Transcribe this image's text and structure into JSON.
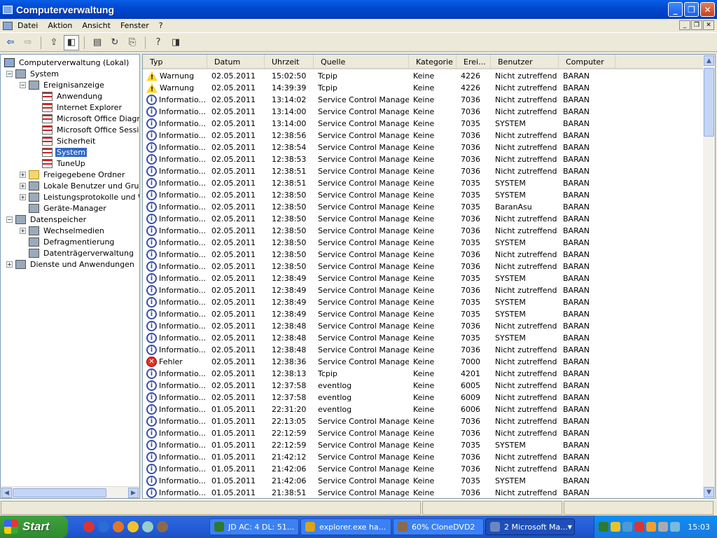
{
  "window": {
    "title": "Computerverwaltung"
  },
  "menubar": {
    "items": [
      "Datei",
      "Aktion",
      "Ansicht",
      "Fenster",
      "?"
    ]
  },
  "tree": {
    "nodes": [
      {
        "label": "Computerverwaltung (Lokal)",
        "icon": "computer-icon"
      },
      {
        "label": "System",
        "icon": "system-icon",
        "expander": "−"
      },
      {
        "label": "Ereignisanzeige",
        "icon": "event-viewer-icon",
        "expander": "−"
      },
      {
        "label": "Anwendung",
        "icon": "log-icon"
      },
      {
        "label": "Internet Explorer",
        "icon": "log-icon"
      },
      {
        "label": "Microsoft Office Diagnos",
        "icon": "log-icon"
      },
      {
        "label": "Microsoft Office Session",
        "icon": "log-icon"
      },
      {
        "label": "Sicherheit",
        "icon": "log-icon"
      },
      {
        "label": "System",
        "icon": "log-icon",
        "selected": true
      },
      {
        "label": "TuneUp",
        "icon": "log-icon"
      },
      {
        "label": "Freigegebene Ordner",
        "icon": "shared-folder-icon",
        "expander": "+"
      },
      {
        "label": "Lokale Benutzer und Gruppe",
        "icon": "users-icon",
        "expander": "+"
      },
      {
        "label": "Leistungsprotokolle und Wa",
        "icon": "performance-icon",
        "expander": "+"
      },
      {
        "label": "Geräte-Manager",
        "icon": "device-manager-icon"
      },
      {
        "label": "Datenspeicher",
        "icon": "storage-icon",
        "expander": "−"
      },
      {
        "label": "Wechselmedien",
        "icon": "removable-media-icon",
        "expander": "+"
      },
      {
        "label": "Defragmentierung",
        "icon": "defrag-icon"
      },
      {
        "label": "Datenträgerverwaltung",
        "icon": "disk-management-icon"
      },
      {
        "label": "Dienste und Anwendungen",
        "icon": "services-icon",
        "expander": "+"
      }
    ]
  },
  "list": {
    "columns": [
      "Typ",
      "Datum",
      "Uhrzeit",
      "Quelle",
      "Kategorie",
      "Erei...",
      "Benutzer",
      "Computer"
    ],
    "rows": [
      {
        "typ": "Warnung",
        "kind": "warn",
        "datum": "02.05.2011",
        "uhrzeit": "15:02:50",
        "quelle": "Tcpip",
        "kategorie": "Keine",
        "ereignis": "4226",
        "benutzer": "Nicht zutreffend",
        "computer": "BARAN"
      },
      {
        "typ": "Warnung",
        "kind": "warn",
        "datum": "02.05.2011",
        "uhrzeit": "14:39:39",
        "quelle": "Tcpip",
        "kategorie": "Keine",
        "ereignis": "4226",
        "benutzer": "Nicht zutreffend",
        "computer": "BARAN"
      },
      {
        "typ": "Informatio...",
        "kind": "info",
        "datum": "02.05.2011",
        "uhrzeit": "13:14:02",
        "quelle": "Service Control Manager",
        "kategorie": "Keine",
        "ereignis": "7036",
        "benutzer": "Nicht zutreffend",
        "computer": "BARAN"
      },
      {
        "typ": "Informatio...",
        "kind": "info",
        "datum": "02.05.2011",
        "uhrzeit": "13:14:00",
        "quelle": "Service Control Manager",
        "kategorie": "Keine",
        "ereignis": "7036",
        "benutzer": "Nicht zutreffend",
        "computer": "BARAN"
      },
      {
        "typ": "Informatio...",
        "kind": "info",
        "datum": "02.05.2011",
        "uhrzeit": "13:14:00",
        "quelle": "Service Control Manager",
        "kategorie": "Keine",
        "ereignis": "7035",
        "benutzer": "SYSTEM",
        "computer": "BARAN"
      },
      {
        "typ": "Informatio...",
        "kind": "info",
        "datum": "02.05.2011",
        "uhrzeit": "12:38:56",
        "quelle": "Service Control Manager",
        "kategorie": "Keine",
        "ereignis": "7036",
        "benutzer": "Nicht zutreffend",
        "computer": "BARAN"
      },
      {
        "typ": "Informatio...",
        "kind": "info",
        "datum": "02.05.2011",
        "uhrzeit": "12:38:54",
        "quelle": "Service Control Manager",
        "kategorie": "Keine",
        "ereignis": "7036",
        "benutzer": "Nicht zutreffend",
        "computer": "BARAN"
      },
      {
        "typ": "Informatio...",
        "kind": "info",
        "datum": "02.05.2011",
        "uhrzeit": "12:38:53",
        "quelle": "Service Control Manager",
        "kategorie": "Keine",
        "ereignis": "7036",
        "benutzer": "Nicht zutreffend",
        "computer": "BARAN"
      },
      {
        "typ": "Informatio...",
        "kind": "info",
        "datum": "02.05.2011",
        "uhrzeit": "12:38:51",
        "quelle": "Service Control Manager",
        "kategorie": "Keine",
        "ereignis": "7036",
        "benutzer": "Nicht zutreffend",
        "computer": "BARAN"
      },
      {
        "typ": "Informatio...",
        "kind": "info",
        "datum": "02.05.2011",
        "uhrzeit": "12:38:51",
        "quelle": "Service Control Manager",
        "kategorie": "Keine",
        "ereignis": "7035",
        "benutzer": "SYSTEM",
        "computer": "BARAN"
      },
      {
        "typ": "Informatio...",
        "kind": "info",
        "datum": "02.05.2011",
        "uhrzeit": "12:38:50",
        "quelle": "Service Control Manager",
        "kategorie": "Keine",
        "ereignis": "7035",
        "benutzer": "SYSTEM",
        "computer": "BARAN"
      },
      {
        "typ": "Informatio...",
        "kind": "info",
        "datum": "02.05.2011",
        "uhrzeit": "12:38:50",
        "quelle": "Service Control Manager",
        "kategorie": "Keine",
        "ereignis": "7035",
        "benutzer": "BaranAsu",
        "computer": "BARAN"
      },
      {
        "typ": "Informatio...",
        "kind": "info",
        "datum": "02.05.2011",
        "uhrzeit": "12:38:50",
        "quelle": "Service Control Manager",
        "kategorie": "Keine",
        "ereignis": "7036",
        "benutzer": "Nicht zutreffend",
        "computer": "BARAN"
      },
      {
        "typ": "Informatio...",
        "kind": "info",
        "datum": "02.05.2011",
        "uhrzeit": "12:38:50",
        "quelle": "Service Control Manager",
        "kategorie": "Keine",
        "ereignis": "7036",
        "benutzer": "Nicht zutreffend",
        "computer": "BARAN"
      },
      {
        "typ": "Informatio...",
        "kind": "info",
        "datum": "02.05.2011",
        "uhrzeit": "12:38:50",
        "quelle": "Service Control Manager",
        "kategorie": "Keine",
        "ereignis": "7035",
        "benutzer": "SYSTEM",
        "computer": "BARAN"
      },
      {
        "typ": "Informatio...",
        "kind": "info",
        "datum": "02.05.2011",
        "uhrzeit": "12:38:50",
        "quelle": "Service Control Manager",
        "kategorie": "Keine",
        "ereignis": "7036",
        "benutzer": "Nicht zutreffend",
        "computer": "BARAN"
      },
      {
        "typ": "Informatio...",
        "kind": "info",
        "datum": "02.05.2011",
        "uhrzeit": "12:38:50",
        "quelle": "Service Control Manager",
        "kategorie": "Keine",
        "ereignis": "7036",
        "benutzer": "Nicht zutreffend",
        "computer": "BARAN"
      },
      {
        "typ": "Informatio...",
        "kind": "info",
        "datum": "02.05.2011",
        "uhrzeit": "12:38:49",
        "quelle": "Service Control Manager",
        "kategorie": "Keine",
        "ereignis": "7035",
        "benutzer": "SYSTEM",
        "computer": "BARAN"
      },
      {
        "typ": "Informatio...",
        "kind": "info",
        "datum": "02.05.2011",
        "uhrzeit": "12:38:49",
        "quelle": "Service Control Manager",
        "kategorie": "Keine",
        "ereignis": "7036",
        "benutzer": "Nicht zutreffend",
        "computer": "BARAN"
      },
      {
        "typ": "Informatio...",
        "kind": "info",
        "datum": "02.05.2011",
        "uhrzeit": "12:38:49",
        "quelle": "Service Control Manager",
        "kategorie": "Keine",
        "ereignis": "7035",
        "benutzer": "SYSTEM",
        "computer": "BARAN"
      },
      {
        "typ": "Informatio...",
        "kind": "info",
        "datum": "02.05.2011",
        "uhrzeit": "12:38:49",
        "quelle": "Service Control Manager",
        "kategorie": "Keine",
        "ereignis": "7035",
        "benutzer": "SYSTEM",
        "computer": "BARAN"
      },
      {
        "typ": "Informatio...",
        "kind": "info",
        "datum": "02.05.2011",
        "uhrzeit": "12:38:48",
        "quelle": "Service Control Manager",
        "kategorie": "Keine",
        "ereignis": "7036",
        "benutzer": "Nicht zutreffend",
        "computer": "BARAN"
      },
      {
        "typ": "Informatio...",
        "kind": "info",
        "datum": "02.05.2011",
        "uhrzeit": "12:38:48",
        "quelle": "Service Control Manager",
        "kategorie": "Keine",
        "ereignis": "7035",
        "benutzer": "SYSTEM",
        "computer": "BARAN"
      },
      {
        "typ": "Informatio...",
        "kind": "info",
        "datum": "02.05.2011",
        "uhrzeit": "12:38:48",
        "quelle": "Service Control Manager",
        "kategorie": "Keine",
        "ereignis": "7036",
        "benutzer": "Nicht zutreffend",
        "computer": "BARAN"
      },
      {
        "typ": "Fehler",
        "kind": "err",
        "datum": "02.05.2011",
        "uhrzeit": "12:38:36",
        "quelle": "Service Control Manager",
        "kategorie": "Keine",
        "ereignis": "7000",
        "benutzer": "Nicht zutreffend",
        "computer": "BARAN"
      },
      {
        "typ": "Informatio...",
        "kind": "info",
        "datum": "02.05.2011",
        "uhrzeit": "12:38:13",
        "quelle": "Tcpip",
        "kategorie": "Keine",
        "ereignis": "4201",
        "benutzer": "Nicht zutreffend",
        "computer": "BARAN"
      },
      {
        "typ": "Informatio...",
        "kind": "info",
        "datum": "02.05.2011",
        "uhrzeit": "12:37:58",
        "quelle": "eventlog",
        "kategorie": "Keine",
        "ereignis": "6005",
        "benutzer": "Nicht zutreffend",
        "computer": "BARAN"
      },
      {
        "typ": "Informatio...",
        "kind": "info",
        "datum": "02.05.2011",
        "uhrzeit": "12:37:58",
        "quelle": "eventlog",
        "kategorie": "Keine",
        "ereignis": "6009",
        "benutzer": "Nicht zutreffend",
        "computer": "BARAN"
      },
      {
        "typ": "Informatio...",
        "kind": "info",
        "datum": "01.05.2011",
        "uhrzeit": "22:31:20",
        "quelle": "eventlog",
        "kategorie": "Keine",
        "ereignis": "6006",
        "benutzer": "Nicht zutreffend",
        "computer": "BARAN"
      },
      {
        "typ": "Informatio...",
        "kind": "info",
        "datum": "01.05.2011",
        "uhrzeit": "22:13:05",
        "quelle": "Service Control Manager",
        "kategorie": "Keine",
        "ereignis": "7036",
        "benutzer": "Nicht zutreffend",
        "computer": "BARAN"
      },
      {
        "typ": "Informatio...",
        "kind": "info",
        "datum": "01.05.2011",
        "uhrzeit": "22:12:59",
        "quelle": "Service Control Manager",
        "kategorie": "Keine",
        "ereignis": "7036",
        "benutzer": "Nicht zutreffend",
        "computer": "BARAN"
      },
      {
        "typ": "Informatio...",
        "kind": "info",
        "datum": "01.05.2011",
        "uhrzeit": "22:12:59",
        "quelle": "Service Control Manager",
        "kategorie": "Keine",
        "ereignis": "7035",
        "benutzer": "SYSTEM",
        "computer": "BARAN"
      },
      {
        "typ": "Informatio...",
        "kind": "info",
        "datum": "01.05.2011",
        "uhrzeit": "21:42:12",
        "quelle": "Service Control Manager",
        "kategorie": "Keine",
        "ereignis": "7036",
        "benutzer": "Nicht zutreffend",
        "computer": "BARAN"
      },
      {
        "typ": "Informatio...",
        "kind": "info",
        "datum": "01.05.2011",
        "uhrzeit": "21:42:06",
        "quelle": "Service Control Manager",
        "kategorie": "Keine",
        "ereignis": "7036",
        "benutzer": "Nicht zutreffend",
        "computer": "BARAN"
      },
      {
        "typ": "Informatio...",
        "kind": "info",
        "datum": "01.05.2011",
        "uhrzeit": "21:42:06",
        "quelle": "Service Control Manager",
        "kategorie": "Keine",
        "ereignis": "7035",
        "benutzer": "SYSTEM",
        "computer": "BARAN"
      },
      {
        "typ": "Informatio...",
        "kind": "info",
        "datum": "01.05.2011",
        "uhrzeit": "21:38:51",
        "quelle": "Service Control Manager",
        "kategorie": "Keine",
        "ereignis": "7036",
        "benutzer": "Nicht zutreffend",
        "computer": "BARAN"
      }
    ]
  },
  "taskbar": {
    "start_label": "Start",
    "quicklaunch": [
      "chrome-icon",
      "ie-icon",
      "firefox-icon",
      "app-icon",
      "ship-icon",
      "clonedvd-icon"
    ],
    "tasks": [
      {
        "label": "JD AC: 4 DL: 51...",
        "icon": "jdownloader-icon",
        "color": "#2d7a2d"
      },
      {
        "label": "explorer.exe ha...",
        "icon": "chrome-icon",
        "color": "#d9a41c"
      },
      {
        "label": "60% CloneDVD2",
        "icon": "clonedvd-icon",
        "color": "#8a6a4a"
      },
      {
        "label": "2 Microsoft Ma...",
        "icon": "mmc-icon",
        "color": "#6a88c0",
        "active": true
      }
    ],
    "clock": "15:03"
  }
}
